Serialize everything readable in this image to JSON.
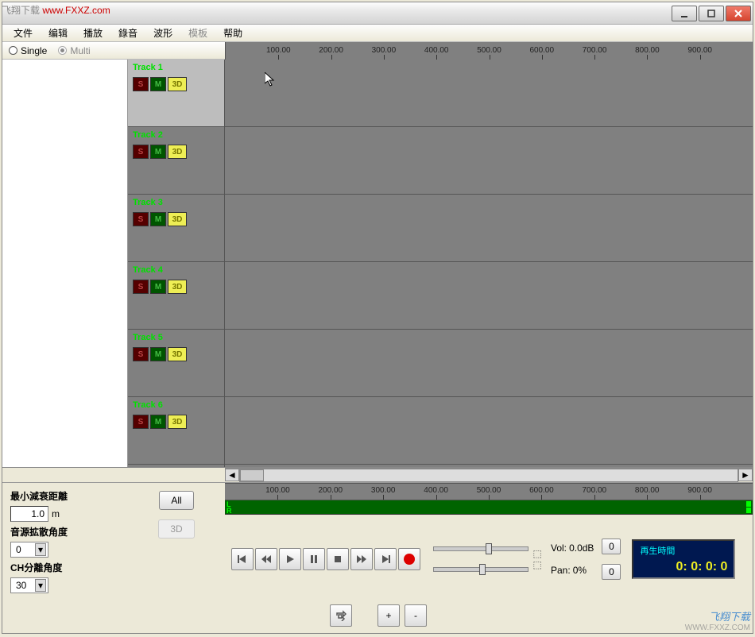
{
  "watermark_top": {
    "prefix": "飞翔下载 ",
    "url": "www.FXXZ.com"
  },
  "menu": {
    "file": "文件",
    "edit": "编辑",
    "play": "播放",
    "record": "錄音",
    "wave": "波形",
    "template": "模板",
    "help": "帮助"
  },
  "mode": {
    "single": "Single",
    "multi": "Multi"
  },
  "ruler_ticks": [
    "100.00",
    "200.00",
    "300.00",
    "400.00",
    "500.00",
    "600.00",
    "700.00",
    "800.00",
    "900.00"
  ],
  "tracks": [
    {
      "name": "Track 1"
    },
    {
      "name": "Track 2"
    },
    {
      "name": "Track 3"
    },
    {
      "name": "Track 4"
    },
    {
      "name": "Track 5"
    },
    {
      "name": "Track 6"
    }
  ],
  "track_btn": {
    "s": "S",
    "m": "M",
    "d3": "3D"
  },
  "controls": {
    "min_decay": "最小減衰距離",
    "min_decay_val": "1.0",
    "min_decay_unit": "m",
    "spread": "音源拡散角度",
    "spread_val": "0",
    "ch_sep": "CH分離角度",
    "ch_sep_val": "30",
    "all": "All",
    "d3": "3D"
  },
  "meters": {
    "l": "L",
    "r": "R"
  },
  "transport": {
    "vol_label": "Vol:",
    "vol_val": "0.0dB",
    "vol_zero": "0",
    "pan_label": "Pan:",
    "pan_val": "0%",
    "pan_zero": "0",
    "plus": "+",
    "minus": "-"
  },
  "time": {
    "title": "再生時間",
    "value": "0: 0: 0: 0"
  },
  "watermark_br": {
    "name": "飞翔下载",
    "url": "WWW.FXXZ.COM"
  }
}
